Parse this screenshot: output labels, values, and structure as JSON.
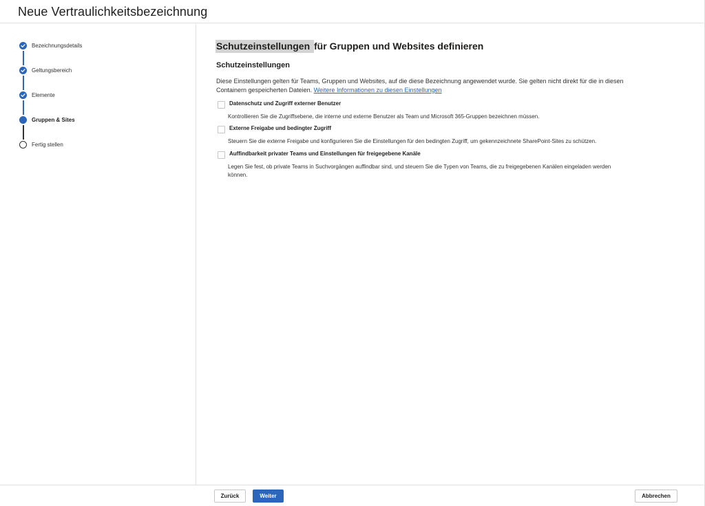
{
  "header": {
    "title": "Neue Vertraulichkeitsbezeichnung"
  },
  "steps": [
    {
      "label": "Bezeichnungsdetails",
      "state": "done"
    },
    {
      "label": "Geltungsbereich",
      "state": "done"
    },
    {
      "label": "Elemente",
      "state": "done"
    },
    {
      "label": "Gruppen & Sites",
      "state": "current"
    },
    {
      "label": "Fertig stellen",
      "state": "todo"
    }
  ],
  "main": {
    "title_highlight": "Schutzeinstellungen ",
    "title_rest": "für Gruppen und Websites definieren",
    "section_title": "Schutzeinstellungen",
    "description": "Diese Einstellungen gelten für Teams, Gruppen und Websites, auf die diese Bezeichnung angewendet wurde. Sie gelten nicht direkt für die in diesen Containern gespeicherten Dateien. ",
    "more_info_link": "Weitere Informationen zu diesen Einstellungen",
    "options": [
      {
        "label": "Datenschutz und Zugriff externer Benutzer",
        "description": "Kontrollieren Sie die Zugriffsebene, die interne und externe Benutzer als Team und Microsoft 365-Gruppen bezeichnen müssen.",
        "checked": false
      },
      {
        "label": "Externe Freigabe und bedingter Zugriff",
        "description": "Steuern Sie die externe Freigabe und konfigurieren Sie die Einstellungen für den bedingten Zugriff, um gekennzeichnete SharePoint-Sites zu schützen.",
        "checked": false
      },
      {
        "label": "Auffindbarkeit privater Teams und Einstellungen für freigegebene Kanäle",
        "description": "Legen Sie fest, ob private Teams in Suchvorgängen auffindbar sind, und steuern Sie die Typen von Teams, die zu freigegebenen Kanälen eingeladen werden können.",
        "checked": false
      }
    ]
  },
  "footer": {
    "back_label": "Zurück",
    "next_label": "Weiter",
    "cancel_label": "Abbrechen"
  },
  "colors": {
    "accent": "#2b66bb",
    "text": "#201f1e",
    "border": "#e1dfdd"
  }
}
